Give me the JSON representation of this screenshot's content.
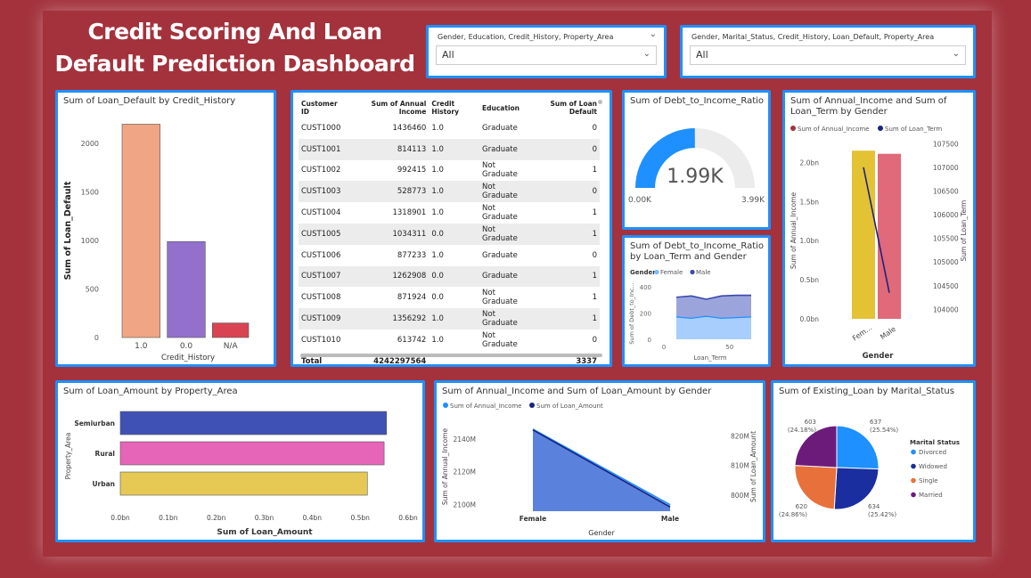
{
  "dashboard_title": "Credit Scoring And Loan Default Prediction Dashboard",
  "slicers": [
    {
      "label": "Gender, Education, Credit_History, Property_Area",
      "value": "All"
    },
    {
      "label": "Gender, Marital_Status, Credit_History, Loan_Default, Property_Area",
      "value": "All"
    }
  ],
  "colors": {
    "background": "#a3323c",
    "card_border": "#1e90ff"
  },
  "table": {
    "headers": [
      "Customer ID",
      "Sum of Annual Income",
      "Credit History",
      "Education",
      "Sum of Loan Default"
    ],
    "rows": [
      [
        "CUST1000",
        "1436460",
        "1.0",
        "Graduate",
        "0"
      ],
      [
        "CUST1001",
        "814113",
        "1.0",
        "Graduate",
        "0"
      ],
      [
        "CUST1002",
        "992415",
        "1.0",
        "Not Graduate",
        "1"
      ],
      [
        "CUST1003",
        "528773",
        "1.0",
        "Not Graduate",
        "0"
      ],
      [
        "CUST1004",
        "1318901",
        "1.0",
        "Not Graduate",
        "1"
      ],
      [
        "CUST1005",
        "1034311",
        "0.0",
        "Not Graduate",
        "1"
      ],
      [
        "CUST1006",
        "877233",
        "1.0",
        "Graduate",
        "0"
      ],
      [
        "CUST1007",
        "1262908",
        "0.0",
        "Graduate",
        "1"
      ],
      [
        "CUST1008",
        "871924",
        "0.0",
        "Not Graduate",
        "1"
      ],
      [
        "CUST1009",
        "1356292",
        "1.0",
        "Not Graduate",
        "1"
      ],
      [
        "CUST1010",
        "613742",
        "1.0",
        "Not Graduate",
        "0"
      ]
    ],
    "total": [
      "Total",
      "4242297564",
      "",
      "",
      "3337"
    ]
  },
  "chart_data": [
    {
      "id": "loan_default_by_credit_history",
      "type": "bar",
      "title": "Sum of Loan_Default by Credit_History",
      "xlabel": "Credit_History",
      "ylabel": "Sum of Loan_Default",
      "categories": [
        "1.0",
        "0.0",
        "N/A"
      ],
      "values": [
        2200,
        990,
        150
      ],
      "colors": [
        "#f0a585",
        "#9370cc",
        "#d94452"
      ],
      "ylim": [
        0,
        2250
      ],
      "yticks": [
        "0",
        "500",
        "1000",
        "1500",
        "2000"
      ],
      "ytick_values": [
        0,
        500,
        1000,
        1500,
        2000
      ]
    },
    {
      "id": "debt_to_income_gauge",
      "type": "gauge",
      "title": "Sum of Debt_to_Income_Ratio",
      "value": 1.99,
      "value_label": "1.99K",
      "min_label": "0.00K",
      "max_label": "3.99K",
      "max": 3.99,
      "color": "#1e90ff"
    },
    {
      "id": "dti_by_loan_term_gender",
      "type": "area",
      "title": "Sum of Debt_to_Income_Ratio by Loan_Term and Gender",
      "legend_title": "Gender",
      "xlabel": "Loan_Term",
      "ylabel": "Sum of Debt_to_Inc...",
      "x": [
        12,
        24,
        36,
        48,
        60,
        72
      ],
      "series": [
        {
          "name": "Female",
          "values": [
            170,
            160,
            175,
            160,
            165,
            170
          ],
          "color": "#7fb8ff"
        },
        {
          "name": "Male",
          "values": [
            320,
            330,
            305,
            330,
            335,
            335
          ],
          "color": "#3949ab"
        }
      ],
      "ylim": [
        0,
        420
      ],
      "yticks": [
        "0",
        "200",
        "400"
      ],
      "ytick_values": [
        0,
        200,
        400
      ],
      "xticks": [
        "0",
        "50"
      ],
      "xtick_values": [
        0,
        50
      ],
      "xlim": [
        0,
        80
      ]
    },
    {
      "id": "income_and_loan_term_by_gender",
      "type": "bar",
      "title": "Sum of Annual_Income and Sum of Loan_Term by Gender",
      "categories": [
        "Fem...",
        "Male"
      ],
      "xlabel": "Gender",
      "ylabel": "Sum of Annual_Income",
      "y2label": "Sum of Loan_Term",
      "series": [
        {
          "name": "Sum of Annual_Income",
          "values": [
            2.15,
            2.11
          ],
          "colors": [
            "#e3c234",
            "#e0697a"
          ],
          "legend_color": "#a3323c"
        },
        {
          "name": "Sum of Loan_Term",
          "values": [
            107000,
            104350
          ],
          "color": "#1a237e",
          "type": "line"
        }
      ],
      "ylim": [
        0,
        2.3
      ],
      "yticks": [
        "0.0bn",
        "0.5bn",
        "1.0bn",
        "1.5bn",
        "2.0bn"
      ],
      "ytick_values": [
        0,
        0.5,
        1.0,
        1.5,
        2.0
      ],
      "y2lim": [
        103800,
        107600
      ],
      "y2ticks": [
        "104000",
        "104500",
        "105000",
        "105500",
        "106000",
        "106500",
        "107000",
        "107500"
      ],
      "y2tick_values": [
        104000,
        104500,
        105000,
        105500,
        106000,
        106500,
        107000,
        107500
      ]
    },
    {
      "id": "loan_amount_by_property_area",
      "type": "bar",
      "orientation": "horizontal",
      "title": "Sum of Loan_Amount by Property_Area",
      "categories": [
        "Semiurban",
        "Rural",
        "Urban"
      ],
      "values": [
        0.555,
        0.55,
        0.515
      ],
      "colors": [
        "#3f51b5",
        "#e665b8",
        "#e6c955"
      ],
      "xlabel": "Sum of Loan_Amount",
      "ylabel": "Property_Area",
      "xlim": [
        0,
        0.6
      ],
      "xticks": [
        "0.0bn",
        "0.1bn",
        "0.2bn",
        "0.3bn",
        "0.4bn",
        "0.5bn",
        "0.6bn"
      ],
      "xtick_values": [
        0,
        0.1,
        0.2,
        0.3,
        0.4,
        0.5,
        0.6
      ]
    },
    {
      "id": "income_and_loan_amount_by_gender",
      "type": "area",
      "title": "Sum of Annual_Income and Sum of Loan_Amount by Gender",
      "categories": [
        "Female",
        "Male"
      ],
      "xlabel": "Gender",
      "ylabel": "Sum of Annual_Income",
      "y2label": "Sum of Loan_Amount",
      "series": [
        {
          "name": "Sum of Annual_Income",
          "values": [
            2146,
            2100
          ],
          "color": "#3d7fd9"
        },
        {
          "name": "Sum of Loan_Amount",
          "values": [
            822,
            796
          ],
          "color": "#1a237e",
          "axis": "right"
        }
      ],
      "ylim": [
        2096,
        2148
      ],
      "yticks": [
        "2100M",
        "2120M",
        "2140M"
      ],
      "ytick_values": [
        2100,
        2120,
        2140
      ],
      "y2lim": [
        794.6,
        823.4
      ],
      "y2ticks": [
        "800M",
        "810M",
        "820M"
      ],
      "y2tick_values": [
        800,
        810,
        820
      ]
    },
    {
      "id": "existing_loan_by_marital_status",
      "type": "pie",
      "title": "Sum of Existing_Loan by Marital_Status",
      "legend_title": "Marital Status",
      "slices": [
        {
          "name": "Divorced",
          "value": 637,
          "label": "637",
          "pct": "(25.54%)",
          "color": "#1e90ff"
        },
        {
          "name": "Widowed",
          "value": 634,
          "label": "634",
          "pct": "(25.42%)",
          "color": "#1a2ea0"
        },
        {
          "name": "Single",
          "value": 620,
          "label": "620",
          "pct": "(24.86%)",
          "color": "#e8703a"
        },
        {
          "name": "Married",
          "value": 603,
          "label": "603",
          "pct": "(24.18%)",
          "color": "#6d1b7b"
        }
      ]
    }
  ]
}
